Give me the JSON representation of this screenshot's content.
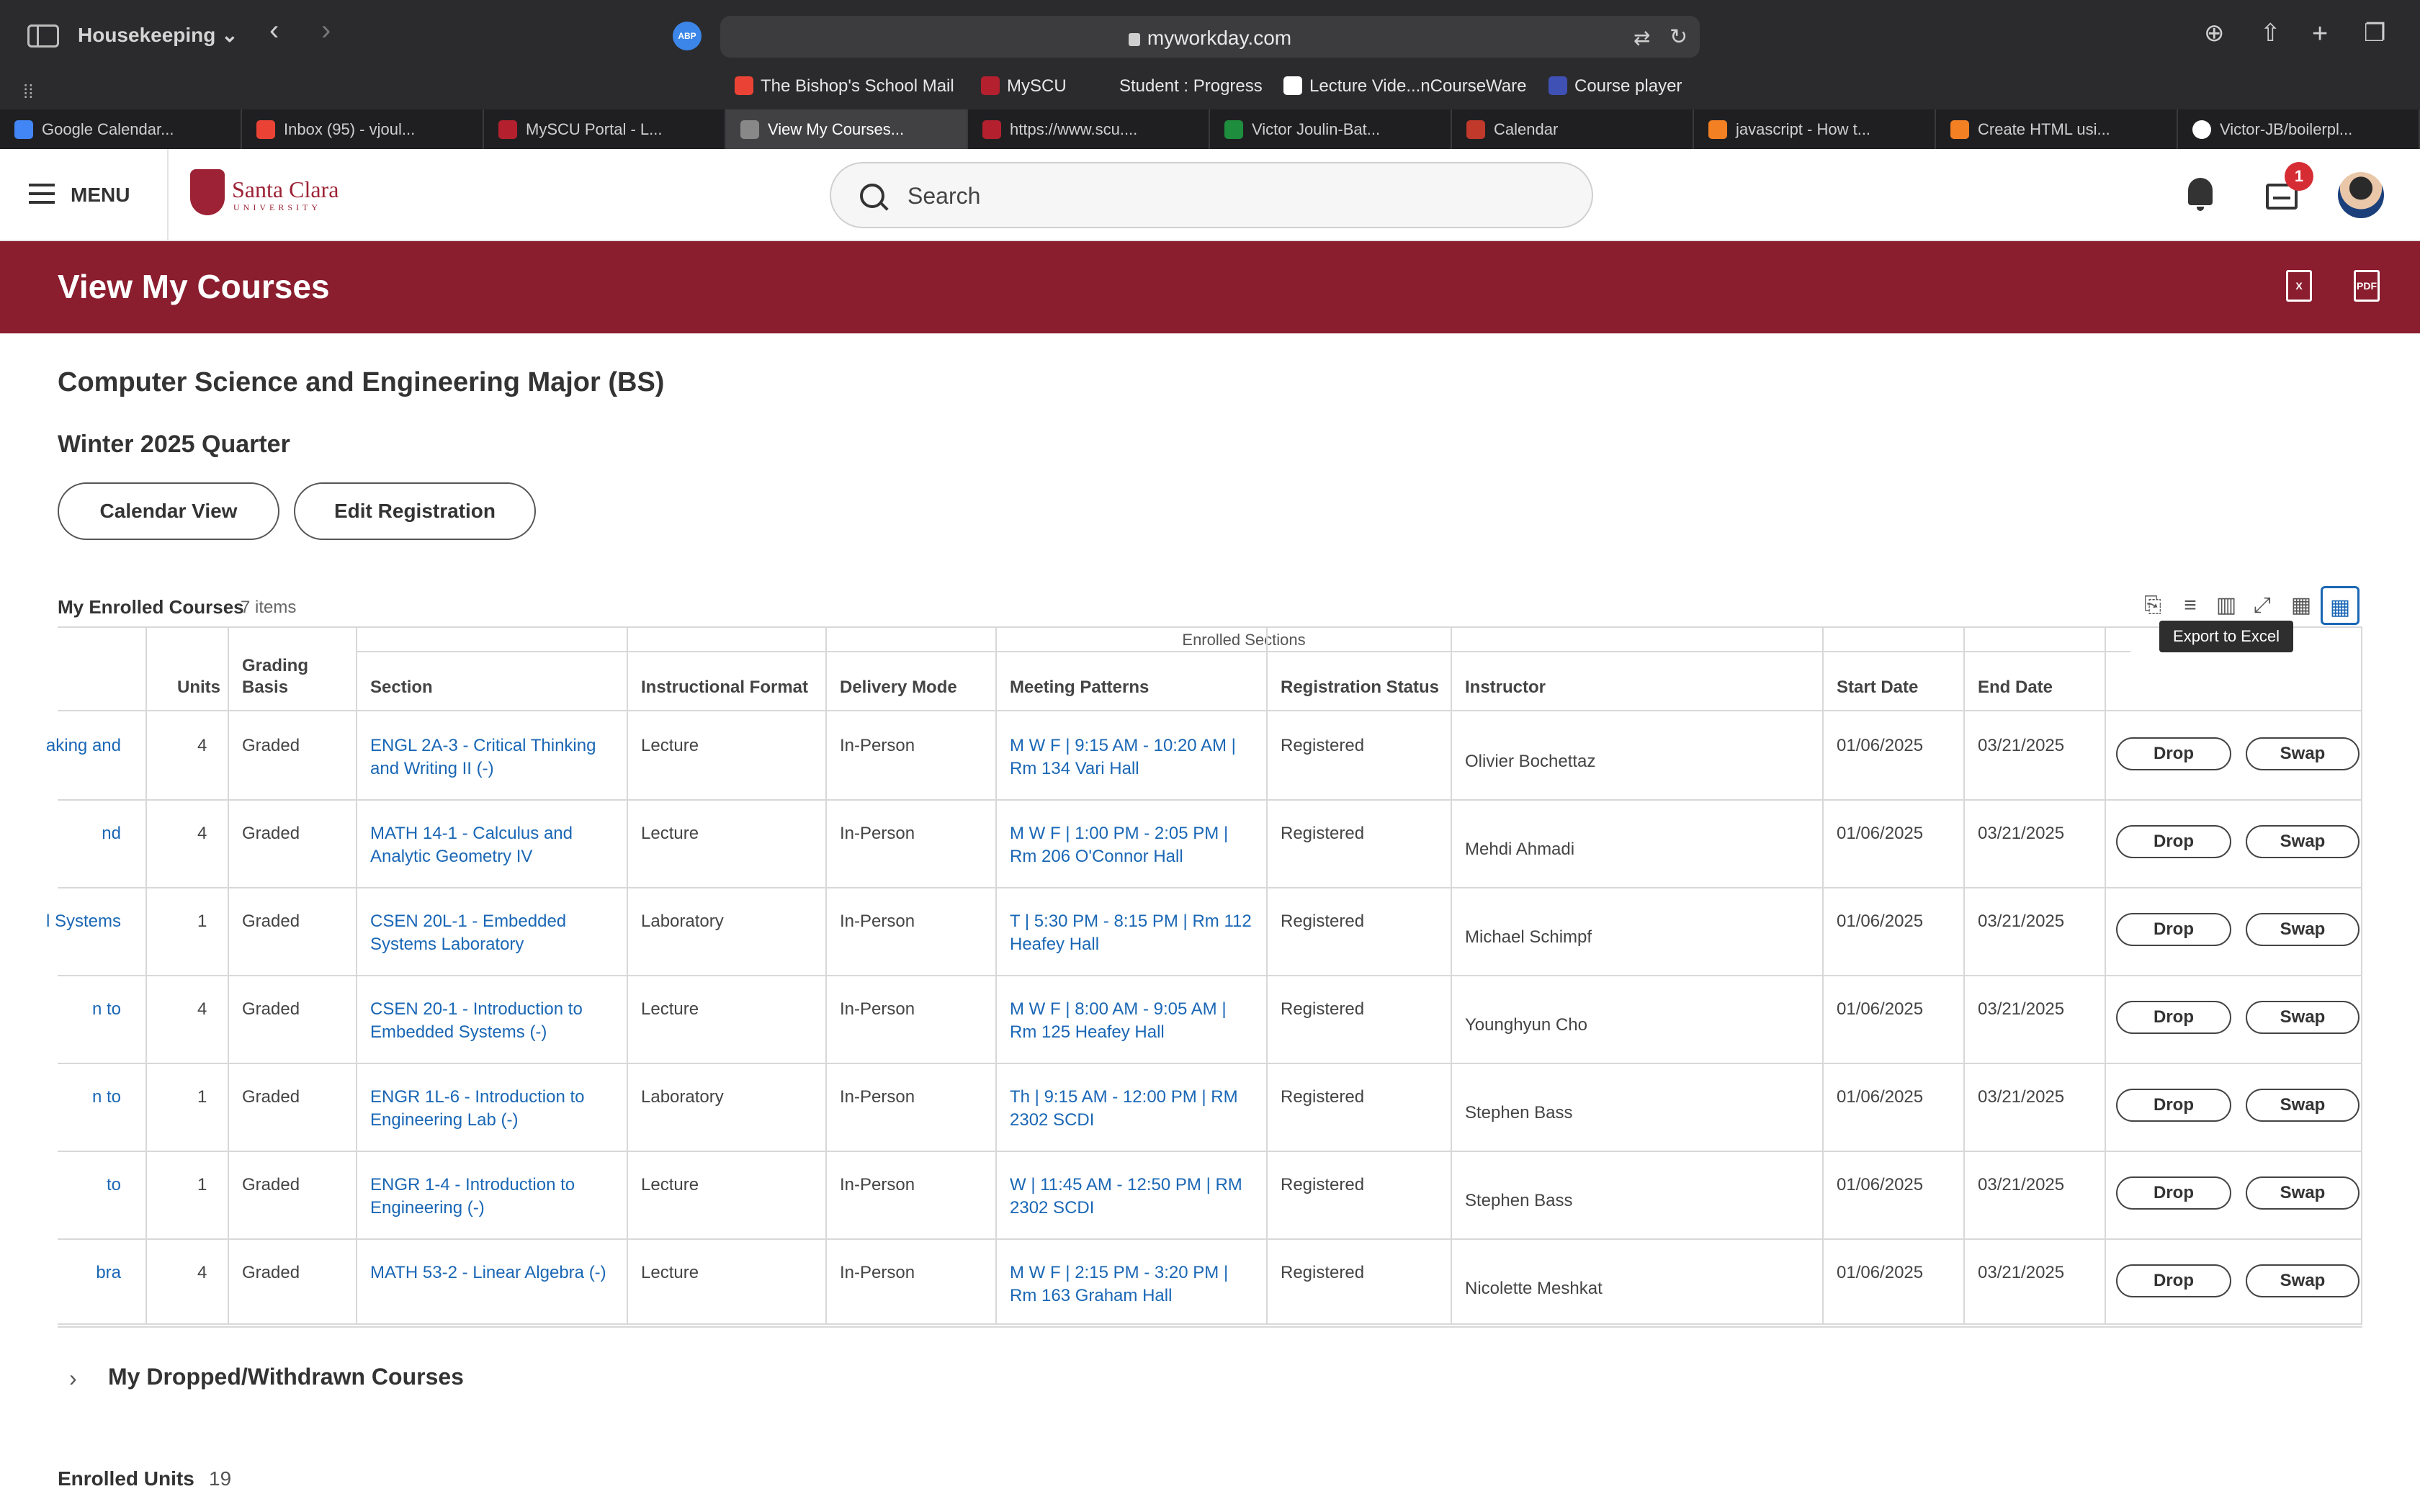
{
  "browser": {
    "profile_name": "Housekeeping",
    "url": "myworkday.com",
    "bookmarks": [
      "The Bishop's School Mail",
      "MySCU",
      "Student : Progress",
      "Lecture Vide...nCourseWare",
      "Course player"
    ],
    "tabs": [
      {
        "label": "Google Calendar...",
        "icon_color": "#4285f4"
      },
      {
        "label": "Inbox (95) - vjoul...",
        "icon_color": "#ea4335"
      },
      {
        "label": "MySCU Portal - L...",
        "icon_color": "#b5202e"
      },
      {
        "label": "View My Courses...",
        "icon_color": "#888888",
        "active": true
      },
      {
        "label": "https://www.scu....",
        "icon_color": "#b5202e"
      },
      {
        "label": "Victor Joulin-Bat...",
        "icon_color": "#1e8e3e"
      },
      {
        "label": "Calendar",
        "icon_color": "#c0392b"
      },
      {
        "label": "javascript - How t...",
        "icon_color": "#f48024"
      },
      {
        "label": "Create HTML usi...",
        "icon_color": "#f48024"
      },
      {
        "label": "Victor-JB/boilerpl...",
        "icon_color": "#ffffff"
      }
    ]
  },
  "header": {
    "menu_label": "MENU",
    "logo_name": "Santa Clara",
    "logo_sub": "UNIVERSITY",
    "search_placeholder": "Search",
    "inbox_badge": "1"
  },
  "page": {
    "title": "View My Courses",
    "major": "Computer Science and Engineering Major (BS)",
    "term": "Winter 2025 Quarter",
    "buttons": {
      "calendar_view": "Calendar View",
      "edit_registration": "Edit Registration"
    }
  },
  "grid": {
    "title": "My Enrolled Courses",
    "count": "7 items",
    "tooltip": "Export to Excel",
    "group_header": "Enrolled Sections",
    "columns": [
      "Units",
      "Grading Basis",
      "Section",
      "Instructional Format",
      "Delivery Mode",
      "Meeting Patterns",
      "Registration Status",
      "Instructor",
      "Start Date",
      "End Date"
    ],
    "drop_label": "Drop",
    "swap_label": "Swap",
    "rows": [
      {
        "course": "aking and",
        "units": "4",
        "grading": "Graded",
        "section": "ENGL 2A-3 - Critical Thinking and Writing II (-)",
        "format": "Lecture",
        "delivery": "In-Person",
        "meeting": "M W F | 9:15 AM - 10:20 AM | Rm 134 Vari Hall",
        "status": "Registered",
        "instructor": "Olivier Bochettaz",
        "start": "01/06/2025",
        "end": "03/21/2025"
      },
      {
        "course": "nd",
        "units": "4",
        "grading": "Graded",
        "section": "MATH 14-1 - Calculus and Analytic Geometry IV",
        "format": "Lecture",
        "delivery": "In-Person",
        "meeting": "M W F | 1:00 PM - 2:05 PM | Rm 206 O'Connor Hall",
        "status": "Registered",
        "instructor": "Mehdi Ahmadi",
        "start": "01/06/2025",
        "end": "03/21/2025"
      },
      {
        "course": "l Systems",
        "units": "1",
        "grading": "Graded",
        "section": "CSEN 20L-1 - Embedded Systems Laboratory",
        "format": "Laboratory",
        "delivery": "In-Person",
        "meeting": "T | 5:30 PM - 8:15 PM | Rm 112 Heafey Hall",
        "status": "Registered",
        "instructor": "Michael Schimpf",
        "start": "01/06/2025",
        "end": "03/21/2025"
      },
      {
        "course": "n to",
        "units": "4",
        "grading": "Graded",
        "section": "CSEN 20-1 - Introduction to Embedded Systems (-)",
        "format": "Lecture",
        "delivery": "In-Person",
        "meeting": "M W F | 8:00 AM - 9:05 AM | Rm 125 Heafey Hall",
        "status": "Registered",
        "instructor": "Younghyun Cho",
        "start": "01/06/2025",
        "end": "03/21/2025"
      },
      {
        "course": "n to",
        "units": "1",
        "grading": "Graded",
        "section": "ENGR 1L-6 - Introduction to Engineering Lab (-)",
        "format": "Laboratory",
        "delivery": "In-Person",
        "meeting": "Th | 9:15 AM - 12:00 PM | RM 2302 SCDI",
        "status": "Registered",
        "instructor": "Stephen Bass",
        "start": "01/06/2025",
        "end": "03/21/2025"
      },
      {
        "course": "to",
        "units": "1",
        "grading": "Graded",
        "section": "ENGR 1-4 - Introduction to Engineering (-)",
        "format": "Lecture",
        "delivery": "In-Person",
        "meeting": "W | 11:45 AM - 12:50 PM | RM 2302 SCDI",
        "status": "Registered",
        "instructor": "Stephen Bass",
        "start": "01/06/2025",
        "end": "03/21/2025"
      },
      {
        "course": "bra",
        "units": "4",
        "grading": "Graded",
        "section": "MATH 53-2 - Linear Algebra (-)",
        "format": "Lecture",
        "delivery": "In-Person",
        "meeting": "M W F | 2:15 PM - 3:20 PM | Rm 163 Graham Hall",
        "status": "Registered",
        "instructor": "Nicolette Meshkat",
        "start": "01/06/2025",
        "end": "03/21/2025"
      }
    ]
  },
  "footer": {
    "dropped_title": "My Dropped/Withdrawn Courses",
    "enrolled_units_label": "Enrolled Units",
    "enrolled_units_value": "19"
  }
}
